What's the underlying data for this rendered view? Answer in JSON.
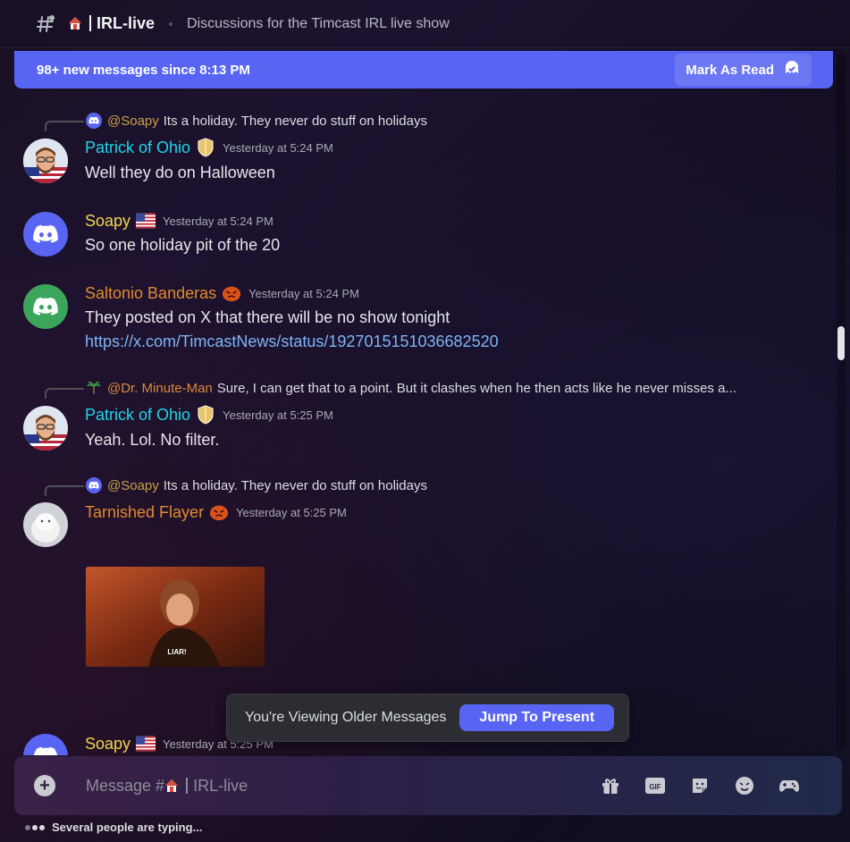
{
  "header": {
    "channel_name": "IRL-live",
    "topic": "Discussions for the Timcast IRL live show"
  },
  "new_messages_bar": {
    "text": "98+ new messages since 8:13 PM",
    "mark_read_label": "Mark As Read"
  },
  "messages": [
    {
      "reply_to": {
        "mention": "@Soapy",
        "text": "Its a holiday. They never do stuff on holidays"
      },
      "author": "Patrick of Ohio",
      "timestamp": "Yesterday at 5:24 PM",
      "content": "Well they do on Halloween"
    },
    {
      "author": "Soapy",
      "timestamp": "Yesterday at 5:24 PM",
      "content": "So one holiday pit of the 20"
    },
    {
      "author": "Saltonio Banderas",
      "timestamp": "Yesterday at 5:24 PM",
      "content": "They posted on X that there will be no show tonight",
      "link": "https://x.com/TimcastNews/status/1927015151036682520"
    },
    {
      "reply_to": {
        "mention": "@Dr. Minute-Man",
        "text": "Sure, I can get that to a point. But it clashes when he then acts like he never misses a..."
      },
      "author": "Patrick of Ohio",
      "timestamp": "Yesterday at 5:25 PM",
      "content": "Yeah. Lol. No filter."
    },
    {
      "reply_to": {
        "mention": "@Soapy",
        "text": "Its a holiday. They never do stuff on holidays"
      },
      "author": "Tarnished Flayer",
      "timestamp": "Yesterday at 5:25 PM",
      "gif_caption": "LIAR!"
    },
    {
      "author": "Soapy",
      "timestamp": "Yesterday at 5:25 PM"
    }
  ],
  "older_popup": {
    "text": "You're Viewing Older Messages",
    "button": "Jump To Present"
  },
  "composer": {
    "placeholder_prefix": "Message #",
    "placeholder_channel": "IRL-live"
  },
  "typing_indicator": "Several people are typing...",
  "colors": {
    "accent": "#5865f2",
    "author_cyan": "#22d3e6",
    "author_yellow": "#f1d54a",
    "author_orange": "#e08a2e",
    "link": "#7eb5f5"
  }
}
